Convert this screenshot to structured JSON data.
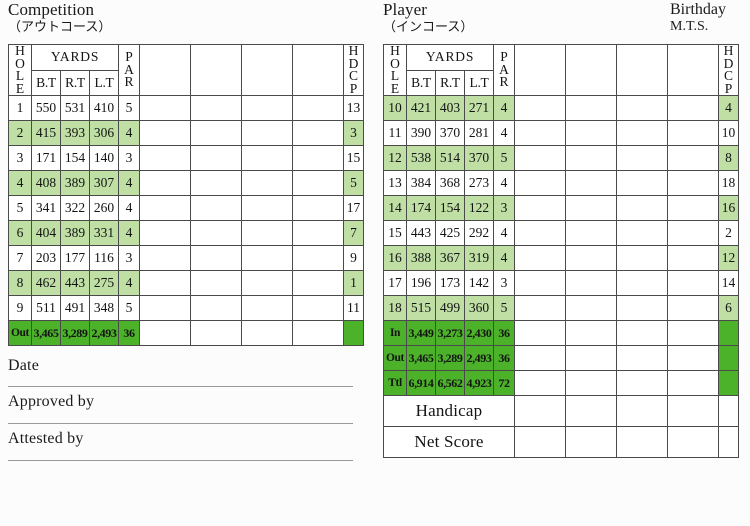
{
  "meta": {
    "background": "#fcfcfc",
    "accent_dark_green": "#5cb82b",
    "accent_total_green": "#4cb22a",
    "accent_light_green": "#bfdfa4",
    "border_color": "#4a4a4a"
  },
  "left": {
    "title": "Competition",
    "subtitle": "（アウトコース）",
    "header": {
      "hole": [
        "H",
        "O",
        "L",
        "E"
      ],
      "yards": "YARDS",
      "sub": [
        "B.T",
        "R.T",
        "L.T"
      ],
      "par": [
        "P",
        "A",
        "R"
      ],
      "hdcp": [
        "H",
        "D",
        "C",
        "P"
      ]
    },
    "rows": [
      {
        "hole": "1",
        "bt": "550",
        "rt": "531",
        "lt": "410",
        "par": "5",
        "hdcp": "13"
      },
      {
        "hole": "2",
        "bt": "415",
        "rt": "393",
        "lt": "306",
        "par": "4",
        "hdcp": "3"
      },
      {
        "hole": "3",
        "bt": "171",
        "rt": "154",
        "lt": "140",
        "par": "3",
        "hdcp": "15"
      },
      {
        "hole": "4",
        "bt": "408",
        "rt": "389",
        "lt": "307",
        "par": "4",
        "hdcp": "5"
      },
      {
        "hole": "5",
        "bt": "341",
        "rt": "322",
        "lt": "260",
        "par": "4",
        "hdcp": "17"
      },
      {
        "hole": "6",
        "bt": "404",
        "rt": "389",
        "lt": "331",
        "par": "4",
        "hdcp": "7"
      },
      {
        "hole": "7",
        "bt": "203",
        "rt": "177",
        "lt": "116",
        "par": "3",
        "hdcp": "9"
      },
      {
        "hole": "8",
        "bt": "462",
        "rt": "443",
        "lt": "275",
        "par": "4",
        "hdcp": "1"
      },
      {
        "hole": "9",
        "bt": "511",
        "rt": "491",
        "lt": "348",
        "par": "5",
        "hdcp": "11"
      }
    ],
    "totals": [
      {
        "label": "Out",
        "bt": "3,465",
        "rt": "3,289",
        "lt": "2,493",
        "par": "36"
      }
    ],
    "signatures": [
      {
        "label": "Date"
      },
      {
        "label": "Approved by"
      },
      {
        "label": "Attested by"
      }
    ]
  },
  "right": {
    "title": "Player",
    "subtitle": "（インコース）",
    "side_title": "Birthday",
    "side_subtitle": "M.T.S.",
    "header": {
      "hole": [
        "H",
        "O",
        "L",
        "E"
      ],
      "yards": "YARDS",
      "sub": [
        "B.T",
        "R.T",
        "L.T"
      ],
      "par": [
        "P",
        "A",
        "R"
      ],
      "hdcp": [
        "H",
        "D",
        "C",
        "P"
      ]
    },
    "rows": [
      {
        "hole": "10",
        "bt": "421",
        "rt": "403",
        "lt": "271",
        "par": "4",
        "hdcp": "4"
      },
      {
        "hole": "11",
        "bt": "390",
        "rt": "370",
        "lt": "281",
        "par": "4",
        "hdcp": "10"
      },
      {
        "hole": "12",
        "bt": "538",
        "rt": "514",
        "lt": "370",
        "par": "5",
        "hdcp": "8"
      },
      {
        "hole": "13",
        "bt": "384",
        "rt": "368",
        "lt": "273",
        "par": "4",
        "hdcp": "18"
      },
      {
        "hole": "14",
        "bt": "174",
        "rt": "154",
        "lt": "122",
        "par": "3",
        "hdcp": "16"
      },
      {
        "hole": "15",
        "bt": "443",
        "rt": "425",
        "lt": "292",
        "par": "4",
        "hdcp": "2"
      },
      {
        "hole": "16",
        "bt": "388",
        "rt": "367",
        "lt": "319",
        "par": "4",
        "hdcp": "12"
      },
      {
        "hole": "17",
        "bt": "196",
        "rt": "173",
        "lt": "142",
        "par": "3",
        "hdcp": "14"
      },
      {
        "hole": "18",
        "bt": "515",
        "rt": "499",
        "lt": "360",
        "par": "5",
        "hdcp": "6"
      }
    ],
    "totals": [
      {
        "label": "In",
        "bt": "3,449",
        "rt": "3,273",
        "lt": "2,430",
        "par": "36"
      },
      {
        "label": "Out",
        "bt": "3,465",
        "rt": "3,289",
        "lt": "2,493",
        "par": "36"
      },
      {
        "label": "Ttl",
        "bt": "6,914",
        "rt": "6,562",
        "lt": "4,923",
        "par": "72"
      }
    ],
    "named_rows": [
      {
        "label": "Handicap"
      },
      {
        "label": "Net Score"
      }
    ]
  }
}
